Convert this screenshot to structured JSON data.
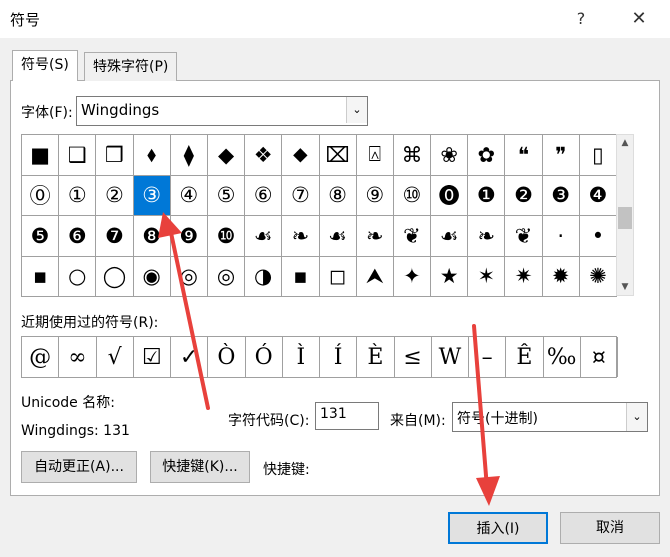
{
  "window": {
    "title": "符号",
    "help": "?",
    "close": "✕"
  },
  "tabs": [
    {
      "label": "符号(S)"
    },
    {
      "label": "特殊字符(P)"
    }
  ],
  "font": {
    "label": "字体(F):",
    "value": "Wingdings",
    "dropdown": "⌄"
  },
  "grid": {
    "selected_index": 19,
    "rows": [
      [
        "■",
        "❑",
        "❒",
        "⬧",
        "⧫",
        "◆",
        "❖",
        "⬥",
        "⌧",
        "⍓",
        "⌘",
        "❀",
        "✿",
        "❝",
        "❞",
        "▯"
      ],
      [
        "⓪",
        "①",
        "②",
        "③",
        "④",
        "⑤",
        "⑥",
        "⑦",
        "⑧",
        "⑨",
        "⑩",
        "⓿",
        "❶",
        "❷",
        "❸",
        "❹"
      ],
      [
        "❺",
        "❻",
        "❼",
        "❽",
        "❾",
        "❿",
        "☙",
        "❧",
        "☙",
        "❧",
        "❦",
        "☙",
        "❧",
        "❦",
        "·",
        "•"
      ],
      [
        "▪",
        "○",
        "◯",
        "◉",
        "◎",
        "◎",
        "◑",
        "▪",
        "◻",
        "⮝",
        "✦",
        "★",
        "✶",
        "✷",
        "✹",
        "✺"
      ]
    ]
  },
  "scrollbar": {
    "up": "▲",
    "down": "▼"
  },
  "recent": {
    "label": "近期使用过的符号(R):",
    "items": [
      "@",
      "∞",
      "√",
      "☑",
      "✓",
      "Ò",
      "Ó",
      "Ì",
      "Í",
      "È",
      "≤",
      "W",
      "–",
      "Ê",
      "‰",
      "¤"
    ]
  },
  "info": {
    "unicode_label": "Unicode 名称:",
    "unicode_value": "Wingdings: 131"
  },
  "code": {
    "label": "字符代码(C):",
    "value": "131"
  },
  "from": {
    "label": "来自(M):",
    "value": "符号(十进制)",
    "dropdown": "⌄"
  },
  "buttons": {
    "autocorrect": "自动更正(A)...",
    "shortcut_key": "快捷键(K)...",
    "shortcut_label": "快捷键:",
    "insert": "插入(I)",
    "cancel": "取消"
  },
  "colors": {
    "accent": "#0078d7",
    "arrow": "#e8413c"
  }
}
